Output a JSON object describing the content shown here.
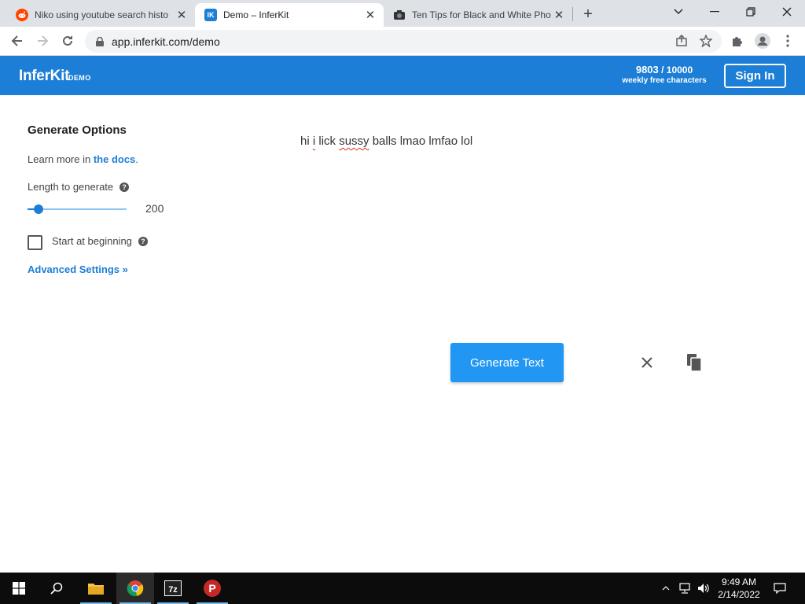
{
  "browser": {
    "tabs": [
      {
        "title": "Niko using youtube search histo",
        "favicon": "reddit-icon"
      },
      {
        "title": "Demo – InferKit",
        "favicon": "inferkit-icon"
      },
      {
        "title": "Ten Tips for Black and White Pho",
        "favicon": "camera-icon"
      }
    ],
    "active_tab": 1,
    "url": "app.inferkit.com/demo"
  },
  "header": {
    "logo": "InferKit",
    "logo_badge": "DEMO",
    "quota_used": "9803",
    "quota_sep": " / ",
    "quota_total": "10000",
    "quota_label": "weekly free characters",
    "sign_in": "Sign In",
    "brand_color": "#1c7ed6"
  },
  "options": {
    "title": "Generate Options",
    "learn_prefix": "Learn more in ",
    "learn_link": "the docs",
    "learn_suffix": ".",
    "length_label": "Length to generate",
    "length_value": "200",
    "start_label": "Start at beginning",
    "start_checked": false,
    "advanced": "Advanced Settings »"
  },
  "editor": {
    "prompt_before": "hi ",
    "prompt_i": "i",
    "prompt_mid": " lick ",
    "prompt_sussy": "sussy",
    "prompt_after": " balls lmao lmfao lol",
    "generate_button": "Generate Text"
  },
  "taskbar": {
    "apps": [
      "start-icon",
      "search-icon",
      "file-explorer-icon",
      "chrome-icon",
      "7zip-icon",
      "psiphon-icon"
    ],
    "time": "9:49 AM",
    "date": "2/14/2022"
  }
}
